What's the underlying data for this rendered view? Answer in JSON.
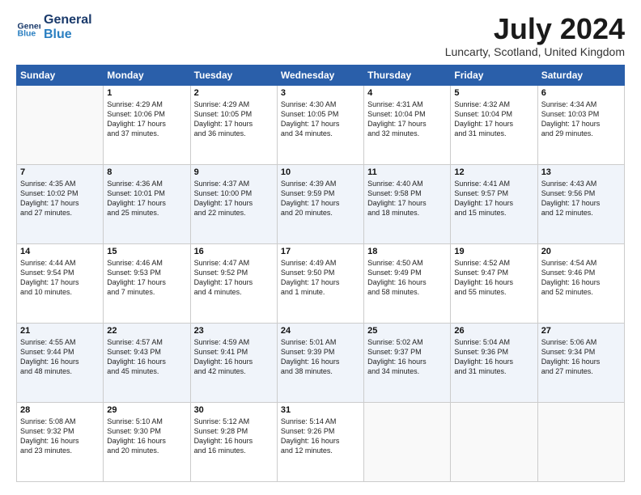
{
  "header": {
    "logo_line1": "General",
    "logo_line2": "Blue",
    "month_title": "July 2024",
    "location": "Luncarty, Scotland, United Kingdom"
  },
  "days_of_week": [
    "Sunday",
    "Monday",
    "Tuesday",
    "Wednesday",
    "Thursday",
    "Friday",
    "Saturday"
  ],
  "weeks": [
    [
      {
        "day": "",
        "info": ""
      },
      {
        "day": "1",
        "info": "Sunrise: 4:29 AM\nSunset: 10:06 PM\nDaylight: 17 hours\nand 37 minutes."
      },
      {
        "day": "2",
        "info": "Sunrise: 4:29 AM\nSunset: 10:05 PM\nDaylight: 17 hours\nand 36 minutes."
      },
      {
        "day": "3",
        "info": "Sunrise: 4:30 AM\nSunset: 10:05 PM\nDaylight: 17 hours\nand 34 minutes."
      },
      {
        "day": "4",
        "info": "Sunrise: 4:31 AM\nSunset: 10:04 PM\nDaylight: 17 hours\nand 32 minutes."
      },
      {
        "day": "5",
        "info": "Sunrise: 4:32 AM\nSunset: 10:04 PM\nDaylight: 17 hours\nand 31 minutes."
      },
      {
        "day": "6",
        "info": "Sunrise: 4:34 AM\nSunset: 10:03 PM\nDaylight: 17 hours\nand 29 minutes."
      }
    ],
    [
      {
        "day": "7",
        "info": "Sunrise: 4:35 AM\nSunset: 10:02 PM\nDaylight: 17 hours\nand 27 minutes."
      },
      {
        "day": "8",
        "info": "Sunrise: 4:36 AM\nSunset: 10:01 PM\nDaylight: 17 hours\nand 25 minutes."
      },
      {
        "day": "9",
        "info": "Sunrise: 4:37 AM\nSunset: 10:00 PM\nDaylight: 17 hours\nand 22 minutes."
      },
      {
        "day": "10",
        "info": "Sunrise: 4:39 AM\nSunset: 9:59 PM\nDaylight: 17 hours\nand 20 minutes."
      },
      {
        "day": "11",
        "info": "Sunrise: 4:40 AM\nSunset: 9:58 PM\nDaylight: 17 hours\nand 18 minutes."
      },
      {
        "day": "12",
        "info": "Sunrise: 4:41 AM\nSunset: 9:57 PM\nDaylight: 17 hours\nand 15 minutes."
      },
      {
        "day": "13",
        "info": "Sunrise: 4:43 AM\nSunset: 9:56 PM\nDaylight: 17 hours\nand 12 minutes."
      }
    ],
    [
      {
        "day": "14",
        "info": "Sunrise: 4:44 AM\nSunset: 9:54 PM\nDaylight: 17 hours\nand 10 minutes."
      },
      {
        "day": "15",
        "info": "Sunrise: 4:46 AM\nSunset: 9:53 PM\nDaylight: 17 hours\nand 7 minutes."
      },
      {
        "day": "16",
        "info": "Sunrise: 4:47 AM\nSunset: 9:52 PM\nDaylight: 17 hours\nand 4 minutes."
      },
      {
        "day": "17",
        "info": "Sunrise: 4:49 AM\nSunset: 9:50 PM\nDaylight: 17 hours\nand 1 minute."
      },
      {
        "day": "18",
        "info": "Sunrise: 4:50 AM\nSunset: 9:49 PM\nDaylight: 16 hours\nand 58 minutes."
      },
      {
        "day": "19",
        "info": "Sunrise: 4:52 AM\nSunset: 9:47 PM\nDaylight: 16 hours\nand 55 minutes."
      },
      {
        "day": "20",
        "info": "Sunrise: 4:54 AM\nSunset: 9:46 PM\nDaylight: 16 hours\nand 52 minutes."
      }
    ],
    [
      {
        "day": "21",
        "info": "Sunrise: 4:55 AM\nSunset: 9:44 PM\nDaylight: 16 hours\nand 48 minutes."
      },
      {
        "day": "22",
        "info": "Sunrise: 4:57 AM\nSunset: 9:43 PM\nDaylight: 16 hours\nand 45 minutes."
      },
      {
        "day": "23",
        "info": "Sunrise: 4:59 AM\nSunset: 9:41 PM\nDaylight: 16 hours\nand 42 minutes."
      },
      {
        "day": "24",
        "info": "Sunrise: 5:01 AM\nSunset: 9:39 PM\nDaylight: 16 hours\nand 38 minutes."
      },
      {
        "day": "25",
        "info": "Sunrise: 5:02 AM\nSunset: 9:37 PM\nDaylight: 16 hours\nand 34 minutes."
      },
      {
        "day": "26",
        "info": "Sunrise: 5:04 AM\nSunset: 9:36 PM\nDaylight: 16 hours\nand 31 minutes."
      },
      {
        "day": "27",
        "info": "Sunrise: 5:06 AM\nSunset: 9:34 PM\nDaylight: 16 hours\nand 27 minutes."
      }
    ],
    [
      {
        "day": "28",
        "info": "Sunrise: 5:08 AM\nSunset: 9:32 PM\nDaylight: 16 hours\nand 23 minutes."
      },
      {
        "day": "29",
        "info": "Sunrise: 5:10 AM\nSunset: 9:30 PM\nDaylight: 16 hours\nand 20 minutes."
      },
      {
        "day": "30",
        "info": "Sunrise: 5:12 AM\nSunset: 9:28 PM\nDaylight: 16 hours\nand 16 minutes."
      },
      {
        "day": "31",
        "info": "Sunrise: 5:14 AM\nSunset: 9:26 PM\nDaylight: 16 hours\nand 12 minutes."
      },
      {
        "day": "",
        "info": ""
      },
      {
        "day": "",
        "info": ""
      },
      {
        "day": "",
        "info": ""
      }
    ]
  ]
}
